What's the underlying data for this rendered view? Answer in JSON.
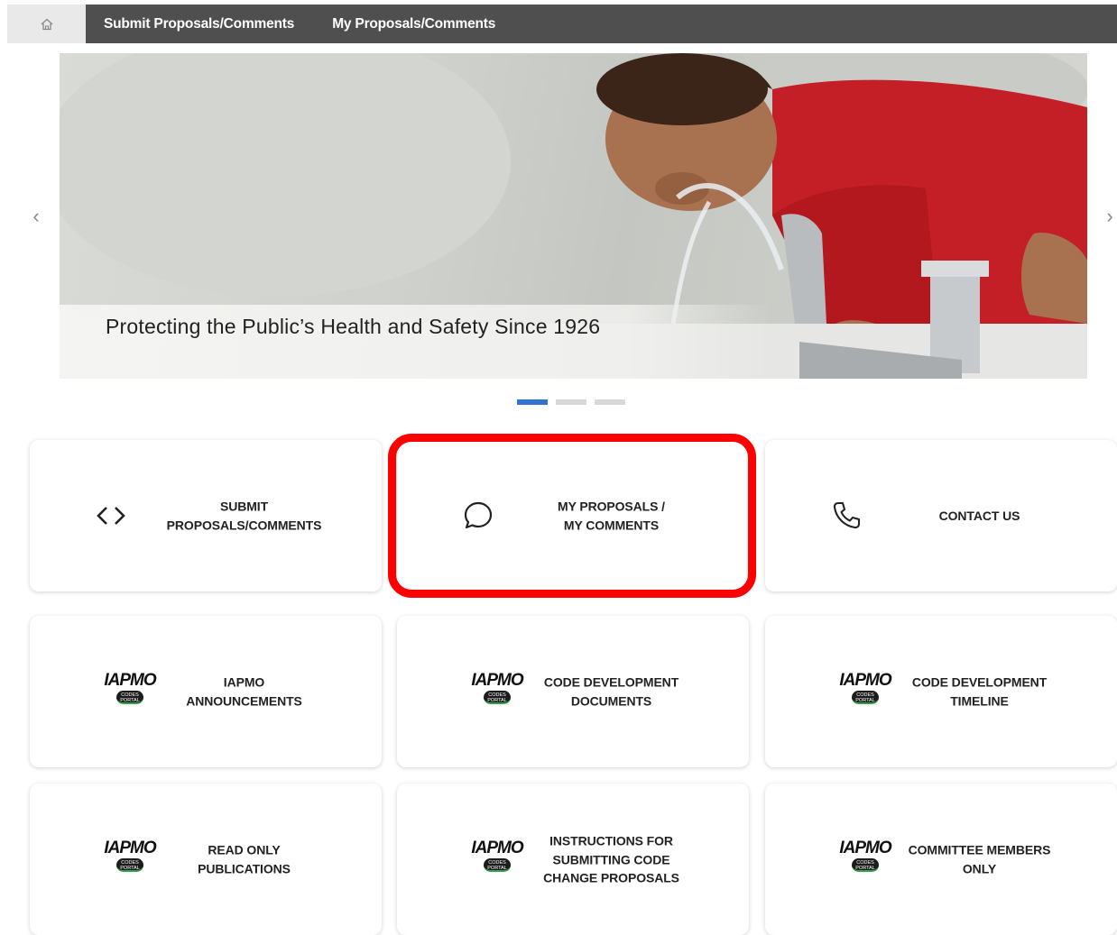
{
  "nav": {
    "items": [
      "Submit Proposals/Comments",
      "My Proposals/Comments"
    ]
  },
  "hero": {
    "caption": "Protecting the Public’s Health and Safety Since 1926",
    "slide_count": 3,
    "active_slide": 0
  },
  "tiles": [
    {
      "label": "SUBMIT\nPROPOSALS/COMMENTS",
      "icon": "code-brackets-icon"
    },
    {
      "label": "MY PROPOSALS /\nMY COMMENTS",
      "icon": "speech-bubble-icon",
      "highlighted": true
    },
    {
      "label": "CONTACT US",
      "icon": "phone-icon"
    },
    {
      "label": "IAPMO\nANNOUNCEMENTS",
      "icon": "iapmo-logo"
    },
    {
      "label": "CODE DEVELOPMENT\nDOCUMENTS",
      "icon": "iapmo-logo"
    },
    {
      "label": "CODE DEVELOPMENT\nTIMELINE",
      "icon": "iapmo-logo"
    },
    {
      "label": "READ ONLY\nPUBLICATIONS",
      "icon": "iapmo-logo"
    },
    {
      "label": "INSTRUCTIONS FOR\nSUBMITTING CODE\nCHANGE PROPOSALS",
      "icon": "iapmo-logo"
    },
    {
      "label": "COMMITTEE MEMBERS\nONLY",
      "icon": "iapmo-logo"
    }
  ],
  "logo": {
    "wordmark": "IAPMO",
    "badge": "CODES PORTAL"
  },
  "colors": {
    "nav_bg": "#4f4f4f",
    "accent": "#2f74d0",
    "highlight": "#ff0000"
  }
}
